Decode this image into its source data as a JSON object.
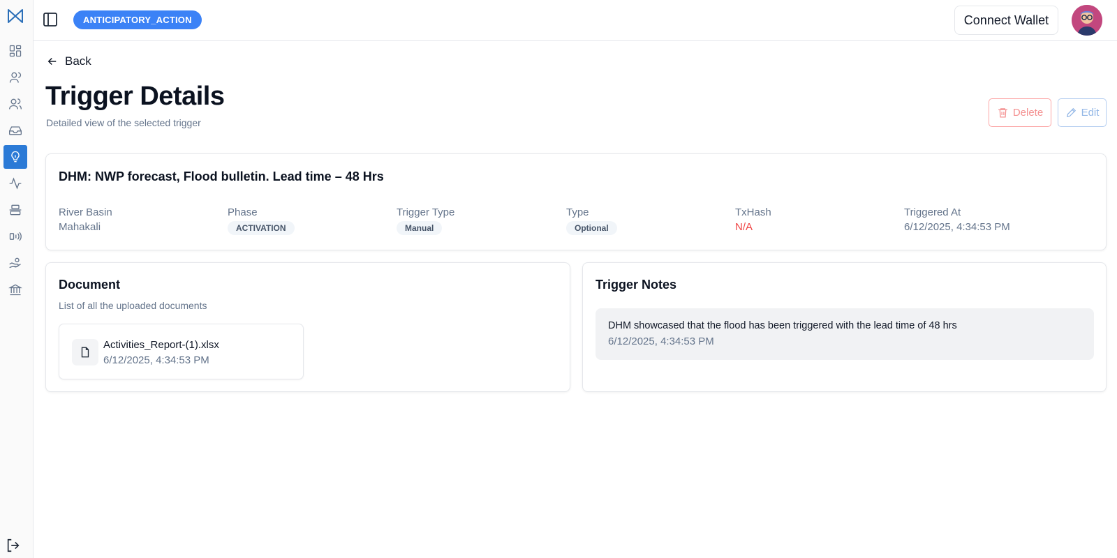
{
  "header": {
    "project_badge": "ANTICIPATORY_ACTION",
    "wallet_button": "Connect Wallet"
  },
  "sidebar": {
    "items": [
      {
        "icon": "dashboard-icon",
        "active": false
      },
      {
        "icon": "user-icon",
        "active": false
      },
      {
        "icon": "users-icon",
        "active": false
      },
      {
        "icon": "inbox-icon",
        "active": false
      },
      {
        "icon": "lightbulb-icon",
        "active": true
      },
      {
        "icon": "activity-icon",
        "active": false
      },
      {
        "icon": "align-center-icon",
        "active": false
      },
      {
        "icon": "signal-icon",
        "active": false
      },
      {
        "icon": "hand-coins-icon",
        "active": false
      },
      {
        "icon": "bank-icon",
        "active": false
      }
    ],
    "active_color": "#2b7ad6"
  },
  "page": {
    "back_label": "Back",
    "title": "Trigger Details",
    "subtitle": "Detailed view of the selected trigger",
    "delete_label": "Delete",
    "edit_label": "Edit"
  },
  "trigger": {
    "title": "DHM: NWP forecast, Flood bulletin. Lead time – 48 Hrs",
    "fields": {
      "river_basin": {
        "label": "River Basin",
        "value": "Mahakali"
      },
      "phase": {
        "label": "Phase",
        "value": "ACTIVATION"
      },
      "trigger_type": {
        "label": "Trigger Type",
        "value": "Manual"
      },
      "type": {
        "label": "Type",
        "value": "Optional"
      },
      "txhash": {
        "label": "TxHash",
        "value": "N/A"
      },
      "triggered_at": {
        "label": "Triggered At",
        "value": "6/12/2025, 4:34:53 PM"
      }
    }
  },
  "document": {
    "heading": "Document",
    "description": "List of all the uploaded documents",
    "files": [
      {
        "name": "Activities_Report-(1).xlsx",
        "date": "6/12/2025, 4:34:53 PM"
      }
    ]
  },
  "notes": {
    "heading": "Trigger Notes",
    "items": [
      {
        "text": "DHM showcased that the flood has been triggered with the lead time of 48 hrs",
        "date": "6/12/2025, 4:34:53 PM"
      }
    ]
  }
}
